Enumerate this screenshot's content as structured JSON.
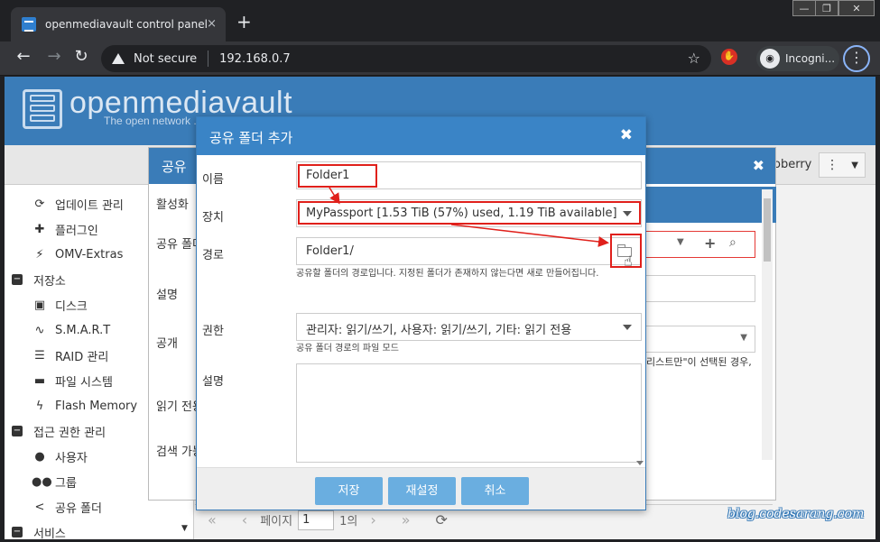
{
  "browser": {
    "tab_title": "openmediavault control panel - o",
    "tab_close": "×",
    "new_tab": "+",
    "window_controls": {
      "minimize": "—",
      "maximize": "❐",
      "close": "✕"
    },
    "security_label": "Not secure",
    "url": "192.168.0.7",
    "incognito_label": "Incogni..."
  },
  "omv": {
    "logo_text": "openmediavault",
    "slogan": "The open network ...",
    "user_label": "oberry",
    "sidebar": [
      {
        "label": "업데이트 관리",
        "icon": "refresh-icon",
        "type": "sub"
      },
      {
        "label": "플러그인",
        "icon": "puzzle-icon",
        "type": "sub"
      },
      {
        "label": "OMV-Extras",
        "icon": "plug-icon",
        "type": "sub"
      },
      {
        "label": "저장소",
        "icon": "minus-square-icon",
        "type": "grp"
      },
      {
        "label": "디스크",
        "icon": "disk-icon",
        "type": "sub"
      },
      {
        "label": "S.M.A.R.T",
        "icon": "pulse-icon",
        "type": "sub"
      },
      {
        "label": "RAID 관리",
        "icon": "database-icon",
        "type": "sub"
      },
      {
        "label": "파일 시스템",
        "icon": "folder-icon",
        "type": "sub"
      },
      {
        "label": "Flash Memory",
        "icon": "bolt-icon",
        "type": "sub"
      },
      {
        "label": "접근 권한 관리",
        "icon": "minus-square-icon",
        "type": "grp"
      },
      {
        "label": "사용자",
        "icon": "user-icon",
        "type": "sub"
      },
      {
        "label": "그룹",
        "icon": "users-icon",
        "type": "sub"
      },
      {
        "label": "공유 폴더",
        "icon": "share-icon",
        "type": "sub"
      },
      {
        "label": "서비스",
        "icon": "minus-square-icon",
        "type": "grp"
      }
    ],
    "bg_panel": {
      "title": "공유",
      "labels": [
        "활성화",
        "공유 폴더",
        "설명",
        "공개",
        "읽기 전용",
        "검색 가능"
      ],
      "note": "리스트만\"이 선택된 경우,"
    },
    "pager": {
      "page_label": "페이지",
      "page_value": "1",
      "of_label": "1의"
    }
  },
  "modal": {
    "title": "공유 폴더 추가",
    "close": "✖",
    "fields": {
      "name_label": "이름",
      "name_value": "Folder1",
      "device_label": "장치",
      "device_value": "MyPassport [1.53 TiB (57%) used, 1.19 TiB available]",
      "path_label": "경로",
      "path_value": "Folder1/",
      "path_help": "공유할 폴더의 경로입니다. 지정된 폴더가 존재하지 않는다면 새로 만들어집니다.",
      "perm_label": "권한",
      "perm_value": "관리자: 읽기/쓰기, 사용자: 읽기/쓰기, 기타: 읽기 전용",
      "perm_help": "공유 폴더 경로의 파일 모드",
      "desc_label": "설명"
    },
    "buttons": {
      "save": "저장",
      "reset": "재설정",
      "cancel": "취소"
    }
  },
  "watermark": "blog.codesarang.com",
  "colors": {
    "accent": "#3a84c6",
    "highlight": "#e0201b",
    "button": "#6aaee0"
  }
}
